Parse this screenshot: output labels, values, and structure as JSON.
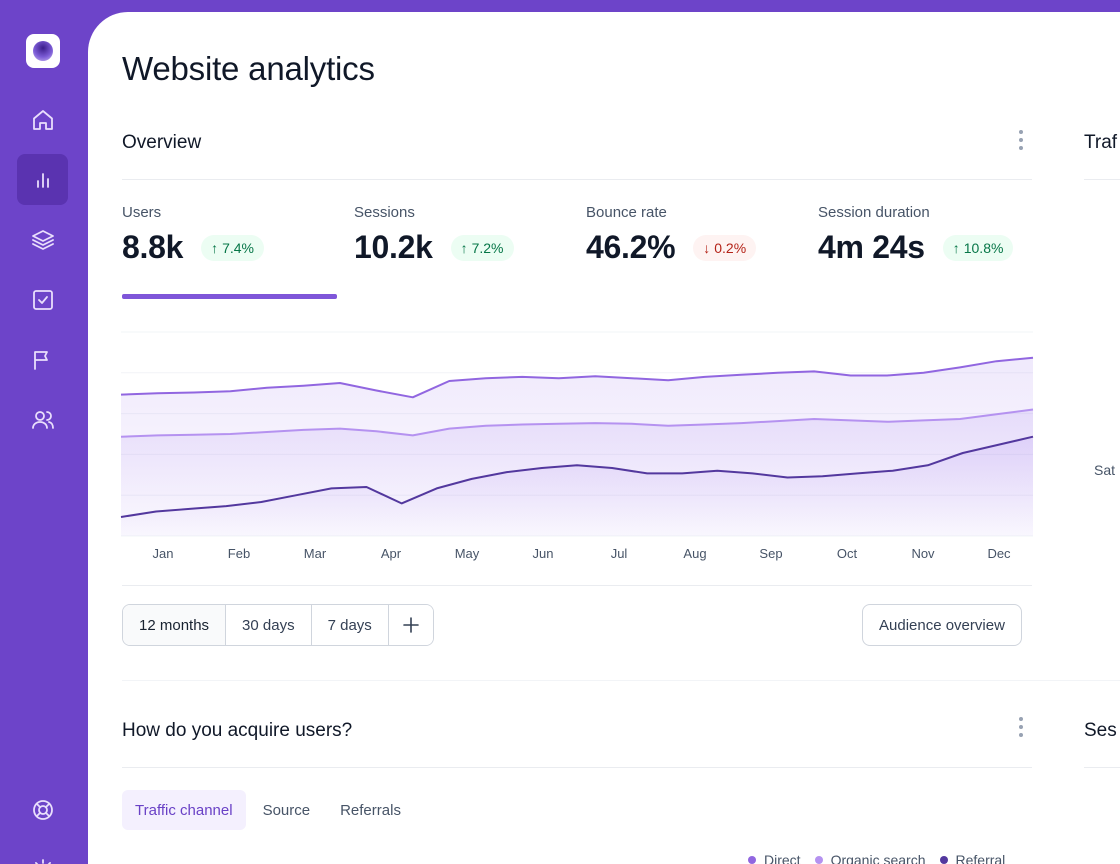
{
  "page": {
    "title": "Website analytics"
  },
  "nav": {
    "items": [
      {
        "name": "home",
        "icon": "home-icon",
        "active": false
      },
      {
        "name": "analytics",
        "icon": "bar-chart-icon",
        "active": true
      },
      {
        "name": "layers",
        "icon": "layers-icon",
        "active": false
      },
      {
        "name": "tasks",
        "icon": "check-square-icon",
        "active": false
      },
      {
        "name": "reports",
        "icon": "flag-icon",
        "active": false
      },
      {
        "name": "users",
        "icon": "users-icon",
        "active": false
      }
    ],
    "bottom": [
      {
        "name": "support",
        "icon": "life-buoy-icon"
      },
      {
        "name": "settings",
        "icon": "gear-icon"
      }
    ]
  },
  "overview": {
    "title": "Overview",
    "metrics": [
      {
        "label": "Users",
        "value": "8.8k",
        "change": "7.4%",
        "direction": "up"
      },
      {
        "label": "Sessions",
        "value": "10.2k",
        "change": "7.2%",
        "direction": "up"
      },
      {
        "label": "Bounce rate",
        "value": "46.2%",
        "change": "0.2%",
        "direction": "down"
      },
      {
        "label": "Session duration",
        "value": "4m 24s",
        "change": "10.8%",
        "direction": "up"
      }
    ],
    "range_buttons": [
      "12 months",
      "30 days",
      "7 days"
    ],
    "active_range": "12 months",
    "add_icon": "plus-icon",
    "audience_button": "Audience overview"
  },
  "chart_data": {
    "type": "area",
    "categories": [
      "Jan",
      "Feb",
      "Mar",
      "Apr",
      "May",
      "Jun",
      "Jul",
      "Aug",
      "Sep",
      "Oct",
      "Nov",
      "Dec"
    ],
    "series": [
      {
        "name": "Direct",
        "color": "#9166e0",
        "values": [
          104,
          105,
          105.5,
          106.5,
          109,
          110.5,
          112.5,
          107,
          102,
          114,
          116,
          117,
          116,
          117.5,
          116,
          114.5,
          117,
          118.5,
          120,
          121,
          118,
          118,
          120,
          124,
          128.5,
          131
        ]
      },
      {
        "name": "Organic search",
        "color": "#b592f0",
        "values": [
          73,
          74,
          74.5,
          75,
          76.5,
          78,
          79,
          77,
          74,
          79,
          81,
          82,
          82.5,
          83,
          82.5,
          81,
          82,
          83,
          84.5,
          86,
          85,
          84,
          85,
          86,
          89.5,
          93
        ]
      },
      {
        "name": "Referral",
        "color": "#53389e",
        "values": [
          14,
          18,
          20,
          22,
          25,
          30,
          35,
          36,
          24,
          35,
          42,
          47,
          50,
          52,
          50,
          46,
          46,
          48,
          46,
          43,
          44,
          46,
          48,
          52,
          61,
          67,
          73
        ]
      }
    ],
    "grid": true
  },
  "acquisition": {
    "title": "How do you acquire users?",
    "tabs": [
      "Traffic channel",
      "Source",
      "Referrals"
    ],
    "active_tab": "Traffic channel",
    "legend": [
      "Direct",
      "Organic search",
      "Referral"
    ]
  },
  "side": {
    "traffic_title": "Traf",
    "sessions_title": "Ses",
    "sat_label": "Sat"
  }
}
